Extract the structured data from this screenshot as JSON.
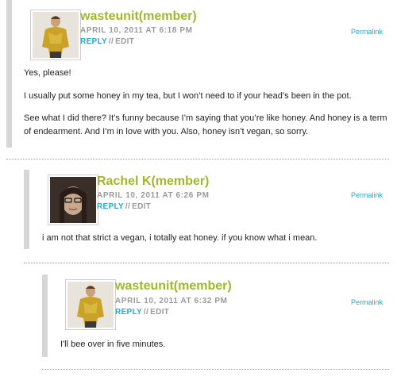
{
  "comments": [
    {
      "author": "wasteunit(member)",
      "date": "APRIL 10, 2011 AT 6:18 PM",
      "reply": "REPLY",
      "sep": "//",
      "edit": "EDIT",
      "permalink": "Permalink",
      "paragraphs": [
        "Yes, please!",
        "I usually put some honey in my tea, but I won’t need to if your head’s been in the pot.",
        "See what I did there? It’s funny because I’m saying that you’re like honey. And honey is a term of endearment. And I’m in love with you. Also, honey isn’t vegan, so sorry."
      ]
    },
    {
      "author": "Rachel K(member)",
      "date": "APRIL 10, 2011 AT 6:26 PM",
      "reply": "REPLY",
      "sep": "//",
      "edit": "EDIT",
      "permalink": "Permalink",
      "paragraphs": [
        "i am not that strict a vegan, i totally eat honey. if you know what i mean."
      ]
    },
    {
      "author": "wasteunit(member)",
      "date": "APRIL 10, 2011 AT 6:32 PM",
      "reply": "REPLY",
      "sep": "//",
      "edit": "EDIT",
      "permalink": "Permalink",
      "paragraphs": [
        "I'll bee over in five minutes."
      ]
    }
  ],
  "colors": {
    "author": "#9cb92b",
    "link": "#2aa7c9",
    "meta": "#9a9a9a",
    "bar": "#d6d6d6"
  }
}
